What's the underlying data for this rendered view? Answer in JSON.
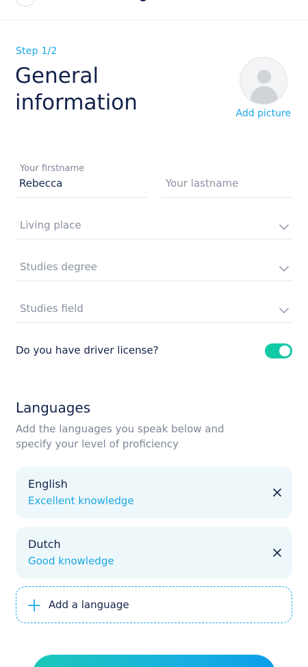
{
  "step": "Step 1/2",
  "title_line1": "General",
  "title_line2": "information",
  "add_picture": "Add picture",
  "form": {
    "firstname_label": "Your firstname",
    "firstname_value": "Rebecca",
    "lastname_placeholder": "Your lastname",
    "living_place_placeholder": "Living place",
    "studies_degree_placeholder": "Studies degree",
    "studies_field_placeholder": "Studies field"
  },
  "driver_license": {
    "label": "Do you have driver license?",
    "enabled": true
  },
  "languages": {
    "title": "Languages",
    "description": "Add the languages you speak below and specify your level of proficiency",
    "items": [
      {
        "name": "English",
        "level": "Excellent knowledge"
      },
      {
        "name": "Dutch",
        "level": "Good knowledge"
      }
    ],
    "add_label": "Add a language"
  },
  "colors": {
    "accent": "#1aa6e4",
    "toggle_on": "#12c9a6",
    "text_dark": "#13224a",
    "card_bg": "#eef8fb"
  },
  "icons": {
    "avatar": "avatar-placeholder-icon",
    "dropdown": "chevron-down-icon",
    "remove": "close-icon",
    "add": "plus-icon"
  }
}
